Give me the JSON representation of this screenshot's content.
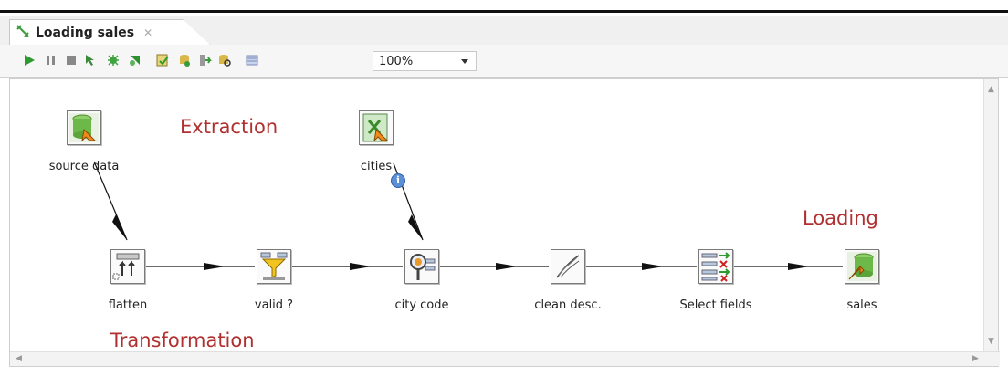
{
  "tab": {
    "title": "Loading sales",
    "close_glyph": "✕"
  },
  "toolbar": {
    "zoom": "100%",
    "buttons": [
      "run-icon",
      "pause-icon",
      "stop-icon",
      "preview-icon",
      "debug-icon",
      "replay-icon",
      "verify-icon",
      "impact-icon",
      "sql-icon",
      "explore-db-icon",
      "show-results-icon"
    ]
  },
  "sections": {
    "extraction": "Extraction",
    "transformation": "Transformation",
    "loading": "Loading"
  },
  "steps": {
    "source_data": "source data",
    "cities": "cities",
    "flatten": "flatten",
    "valid": "valid ?",
    "city_code": "city code",
    "clean_desc": "clean desc.",
    "select_fields": "Select fields",
    "sales": "sales"
  },
  "colors": {
    "section": "#b03030",
    "hop": "#111111"
  }
}
